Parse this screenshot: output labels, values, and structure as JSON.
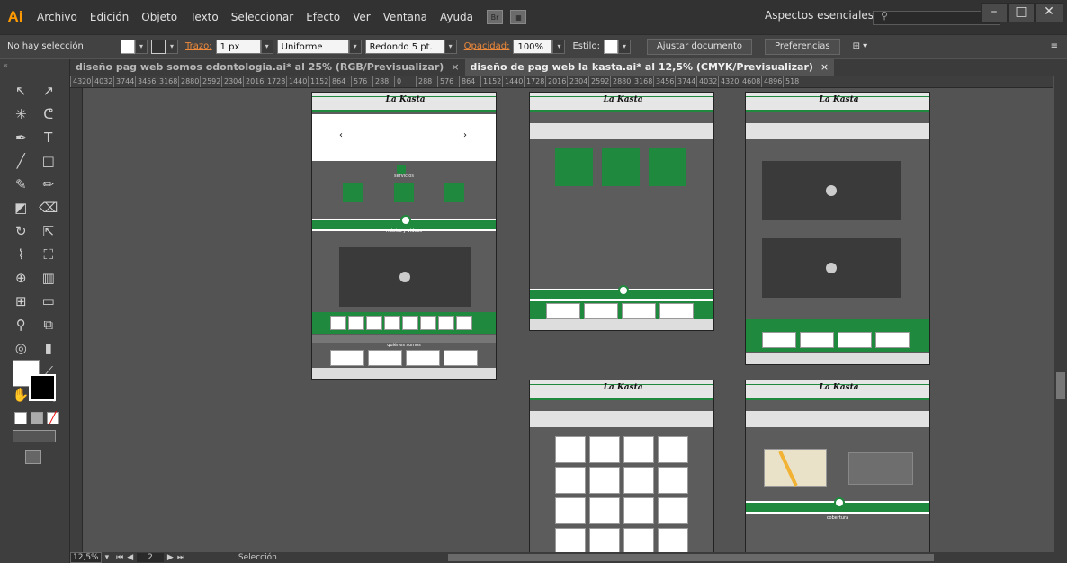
{
  "app": {
    "logo": "Ai"
  },
  "menu": [
    "Archivo",
    "Edición",
    "Objeto",
    "Texto",
    "Seleccionar",
    "Efecto",
    "Ver",
    "Ventana",
    "Ayuda"
  ],
  "workspace": {
    "label": "Aspectos esenciales"
  },
  "control": {
    "selection": "No hay selección",
    "stroke_label": "Trazo:",
    "stroke_weight": "1 px",
    "stroke_profile": "Uniforme",
    "brush": "Redondo 5 pt.",
    "opacity_label": "Opacidad:",
    "opacity_value": "100%",
    "style_label": "Estilo:",
    "fit_doc": "Ajustar documento",
    "preferences": "Preferencias"
  },
  "tabs": [
    {
      "label": "diseño pag web somos odontologia.ai* al 25% (RGB/Previsualizar)",
      "active": false
    },
    {
      "label": "diseño de pag web la kasta.ai* al 12,5% (CMYK/Previsualizar)",
      "active": true
    }
  ],
  "ruler": [
    "4320",
    "4032",
    "3744",
    "3456",
    "3168",
    "2880",
    "2592",
    "2304",
    "2016",
    "1728",
    "1440",
    "1152",
    "864",
    "576",
    "288",
    "0",
    "288",
    "576",
    "864",
    "1152",
    "1440",
    "1728",
    "2016",
    "2304",
    "2592",
    "2880",
    "3168",
    "3456",
    "3744",
    "4032",
    "4320",
    "4608",
    "4896",
    "518"
  ],
  "status": {
    "zoom": "12,5%",
    "page": "2",
    "mode": "Selección"
  },
  "artboard_labels": {
    "services": "servicios",
    "music": "música y videos",
    "about": "quiénes somos",
    "coverage": "cobertura"
  }
}
